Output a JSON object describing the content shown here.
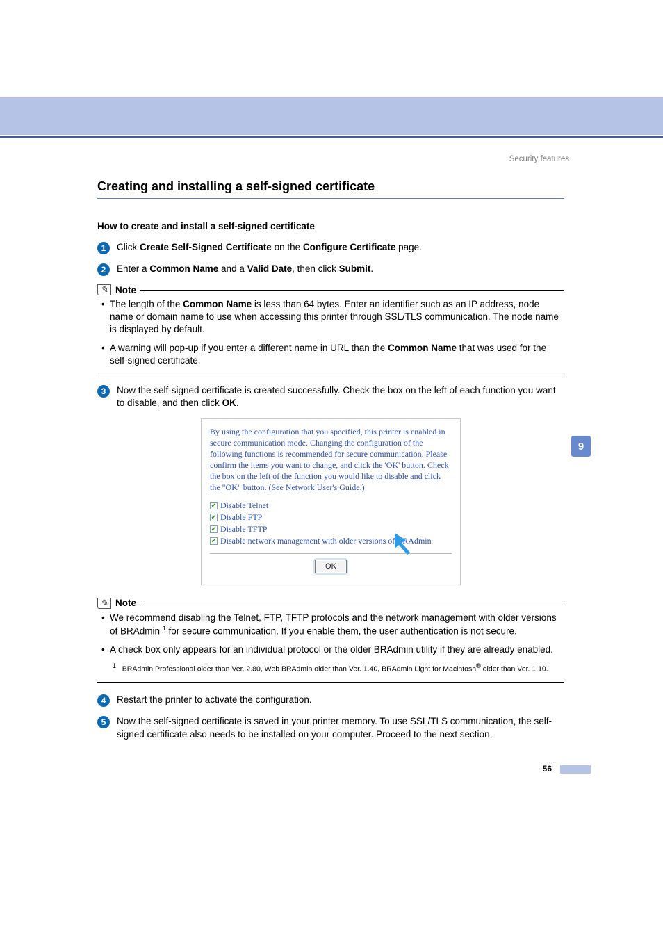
{
  "header": {
    "running_head": "Security features"
  },
  "chapter": {
    "number": "9"
  },
  "page": {
    "number": "56"
  },
  "h1": "Creating and installing a self-signed certificate",
  "h2": "How to create and install a self-signed certificate",
  "steps": {
    "s1": {
      "num": "1",
      "pre": "Click ",
      "b1": "Create Self-Signed Certificate",
      "mid": " on the ",
      "b2": "Configure Certificate",
      "post": " page."
    },
    "s2": {
      "num": "2",
      "pre": "Enter a ",
      "b1": "Common Name",
      "mid": " and a ",
      "b2": "Valid Date",
      "mid2": ", then click ",
      "b3": "Submit",
      "post": "."
    },
    "s3": {
      "num": "3",
      "pre": "Now the self-signed certificate is created successfully. Check the box on the left of each function you want to disable, and then click ",
      "b1": "OK",
      "post": "."
    },
    "s4": {
      "num": "4",
      "text": "Restart the printer to activate the configuration."
    },
    "s5": {
      "num": "5",
      "text": "Now the self-signed certificate is saved in your printer memory. To use SSL/TLS communication, the self-signed certificate also needs to be installed on your computer. Proceed to the next section."
    }
  },
  "note_label": "Note",
  "note1": {
    "i1": {
      "pre": "The length of the ",
      "b1": "Common Name",
      "post": " is less than 64 bytes. Enter an identifier such as an IP address, node name or domain name to use when accessing this printer through SSL/TLS communication. The node name is displayed by default."
    },
    "i2": {
      "pre": "A warning will pop-up if you enter a different name in URL than the ",
      "b1": "Common Name",
      "post": " that was used for the self-signed certificate."
    }
  },
  "note2": {
    "i1": {
      "pre": "We recommend disabling the Telnet, FTP, TFTP protocols and the network management with older versions of BRAdmin ",
      "sup": "1",
      "post": " for secure communication. If you enable them, the user authentication is not secure."
    },
    "i2": {
      "text": "A check box only appears for an individual protocol or the older BRAdmin utility if they are already enabled."
    },
    "foot": {
      "sup": "1",
      "pre": "BRAdmin Professional older than Ver. 2.80, Web BRAdmin older than Ver. 1.40, BRAdmin Light for Macintosh",
      "reg": "®",
      "post": " older than Ver. 1.10."
    }
  },
  "dialog": {
    "para": "By using the configuration that you specified, this printer is enabled in secure communication mode. Changing the configuration of the following functions is recommended for secure communication. Please confirm the items you want to change, and click the 'OK' button. Check the box on the left of the function you would like to disable and click the \"OK\" button. (See Network User's Guide.)",
    "cb1": "Disable Telnet",
    "cb2": "Disable FTP",
    "cb3": "Disable TFTP",
    "cb4": "Disable network management with older versions of BRAdmin",
    "ok": "OK"
  }
}
